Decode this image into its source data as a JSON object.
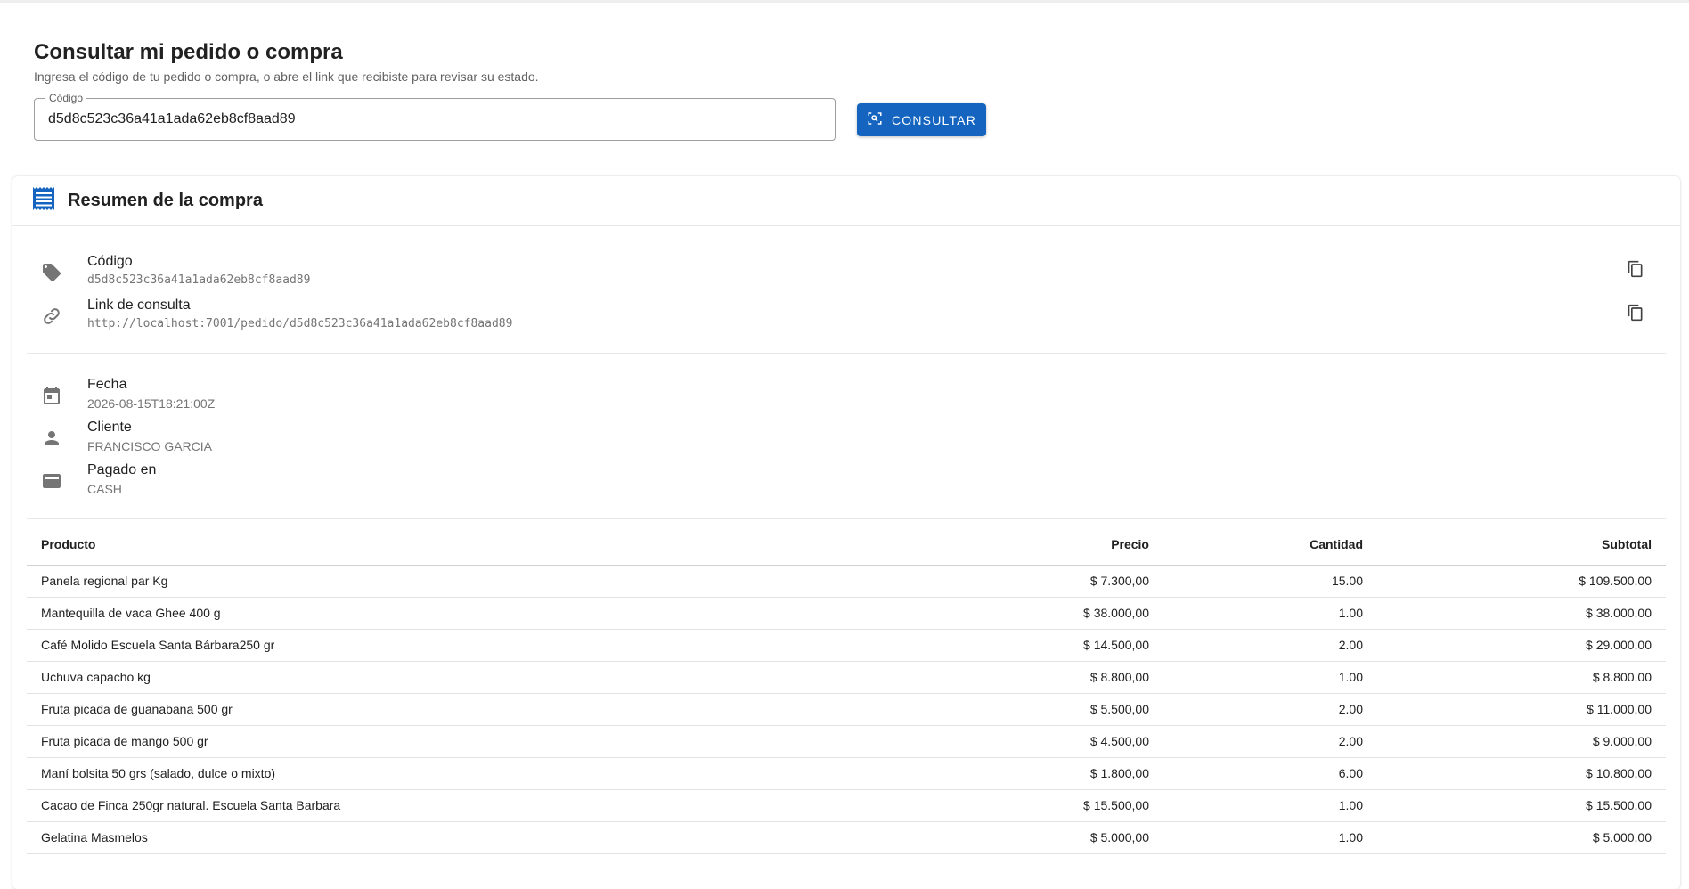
{
  "header": {
    "title": "Consultar mi pedido o compra",
    "subtitle": "Ingresa el código de tu pedido o compra, o abre el link que recibiste para revisar su estado."
  },
  "search": {
    "label": "Código",
    "value": "d5d8c523c36a41a1ada62eb8cf8aad89",
    "button_label": "CONSULTAR"
  },
  "summary": {
    "title": "Resumen de la compra",
    "code_label": "Código",
    "code_value": "d5d8c523c36a41a1ada62eb8cf8aad89",
    "link_label": "Link de consulta",
    "link_value": "http://localhost:7001/pedido/d5d8c523c36a41a1ada62eb8cf8aad89",
    "date_label": "Fecha",
    "date_value": "2026-08-15T18:21:00Z",
    "client_label": "Cliente",
    "client_value": "FRANCISCO GARCIA",
    "paid_label": "Pagado en",
    "paid_value": "CASH"
  },
  "table": {
    "headers": {
      "product": "Producto",
      "price": "Precio",
      "qty": "Cantidad",
      "subtotal": "Subtotal"
    },
    "rows": [
      {
        "product": "Panela regional par Kg",
        "price": "$ 7.300,00",
        "qty": "15.00",
        "subtotal": "$ 109.500,00"
      },
      {
        "product": "Mantequilla de vaca Ghee 400 g",
        "price": "$ 38.000,00",
        "qty": "1.00",
        "subtotal": "$ 38.000,00"
      },
      {
        "product": "Café Molido Escuela Santa Bárbara250 gr",
        "price": "$ 14.500,00",
        "qty": "2.00",
        "subtotal": "$ 29.000,00"
      },
      {
        "product": "Uchuva capacho kg",
        "price": "$ 8.800,00",
        "qty": "1.00",
        "subtotal": "$ 8.800,00"
      },
      {
        "product": "Fruta picada de guanabana 500 gr",
        "price": "$ 5.500,00",
        "qty": "2.00",
        "subtotal": "$ 11.000,00"
      },
      {
        "product": "Fruta picada de mango 500 gr",
        "price": "$ 4.500,00",
        "qty": "2.00",
        "subtotal": "$ 9.000,00"
      },
      {
        "product": "Maní bolsita 50 grs (salado, dulce o mixto)",
        "price": "$ 1.800,00",
        "qty": "6.00",
        "subtotal": "$ 10.800,00"
      },
      {
        "product": "Cacao de Finca 250gr natural. Escuela Santa Barbara",
        "price": "$ 15.500,00",
        "qty": "1.00",
        "subtotal": "$ 15.500,00"
      },
      {
        "product": "Gelatina Masmelos",
        "price": "$ 5.000,00",
        "qty": "1.00",
        "subtotal": "$ 5.000,00"
      }
    ]
  },
  "icons": {
    "consult": "qr-scan-icon",
    "receipt": "receipt-icon",
    "code": "tag-icon",
    "link": "link-icon",
    "copy": "copy-icon",
    "date": "calendar-icon",
    "client": "person-icon",
    "paid": "credit-card-icon"
  },
  "colors": {
    "primary": "#1565c0",
    "icon_gray": "#757575"
  }
}
